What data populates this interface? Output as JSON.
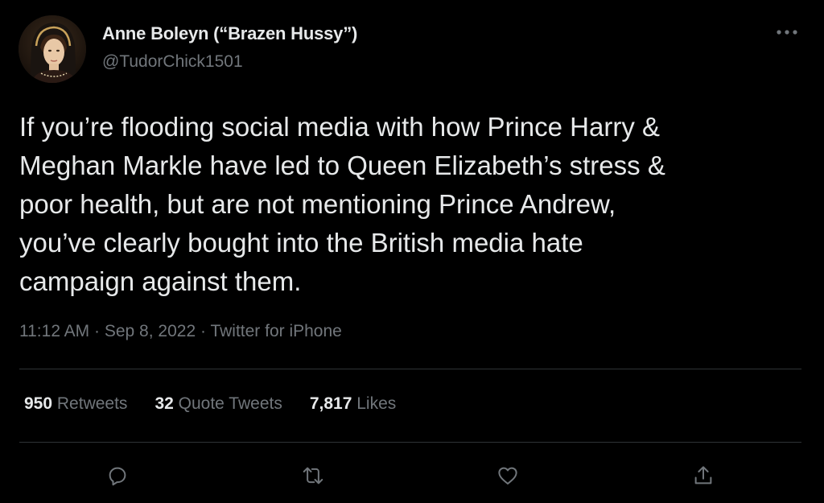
{
  "author": {
    "display_name": "Anne Boleyn (“Brazen Hussy”)",
    "handle": "@TudorChick1501",
    "avatar_icon": "portrait-avatar"
  },
  "tweet": {
    "text_lines": [
      "If you’re flooding social media with how Prince Harry &",
      "Meghan Markle have led to Queen Elizabeth’s stress &",
      "poor health, but are not mentioning Prince Andrew,",
      "you’ve clearly bought into the British media hate",
      "campaign against them."
    ],
    "time": "11:12 AM",
    "separator": "·",
    "date": "Sep 8, 2022",
    "source": "Twitter for iPhone"
  },
  "stats": {
    "retweets_count": "950",
    "retweets_label": "Retweets",
    "quotes_count": "32",
    "quotes_label": "Quote Tweets",
    "likes_count": "7,817",
    "likes_label": "Likes"
  },
  "actions": {
    "reply_icon": "reply-icon",
    "retweet_icon": "retweet-icon",
    "like_icon": "heart-icon",
    "share_icon": "share-icon",
    "more_icon": "more-icon"
  },
  "colors": {
    "background": "#000000",
    "primary_text": "#e7e9ea",
    "secondary_text": "#71767b",
    "divider": "#2f3336"
  }
}
